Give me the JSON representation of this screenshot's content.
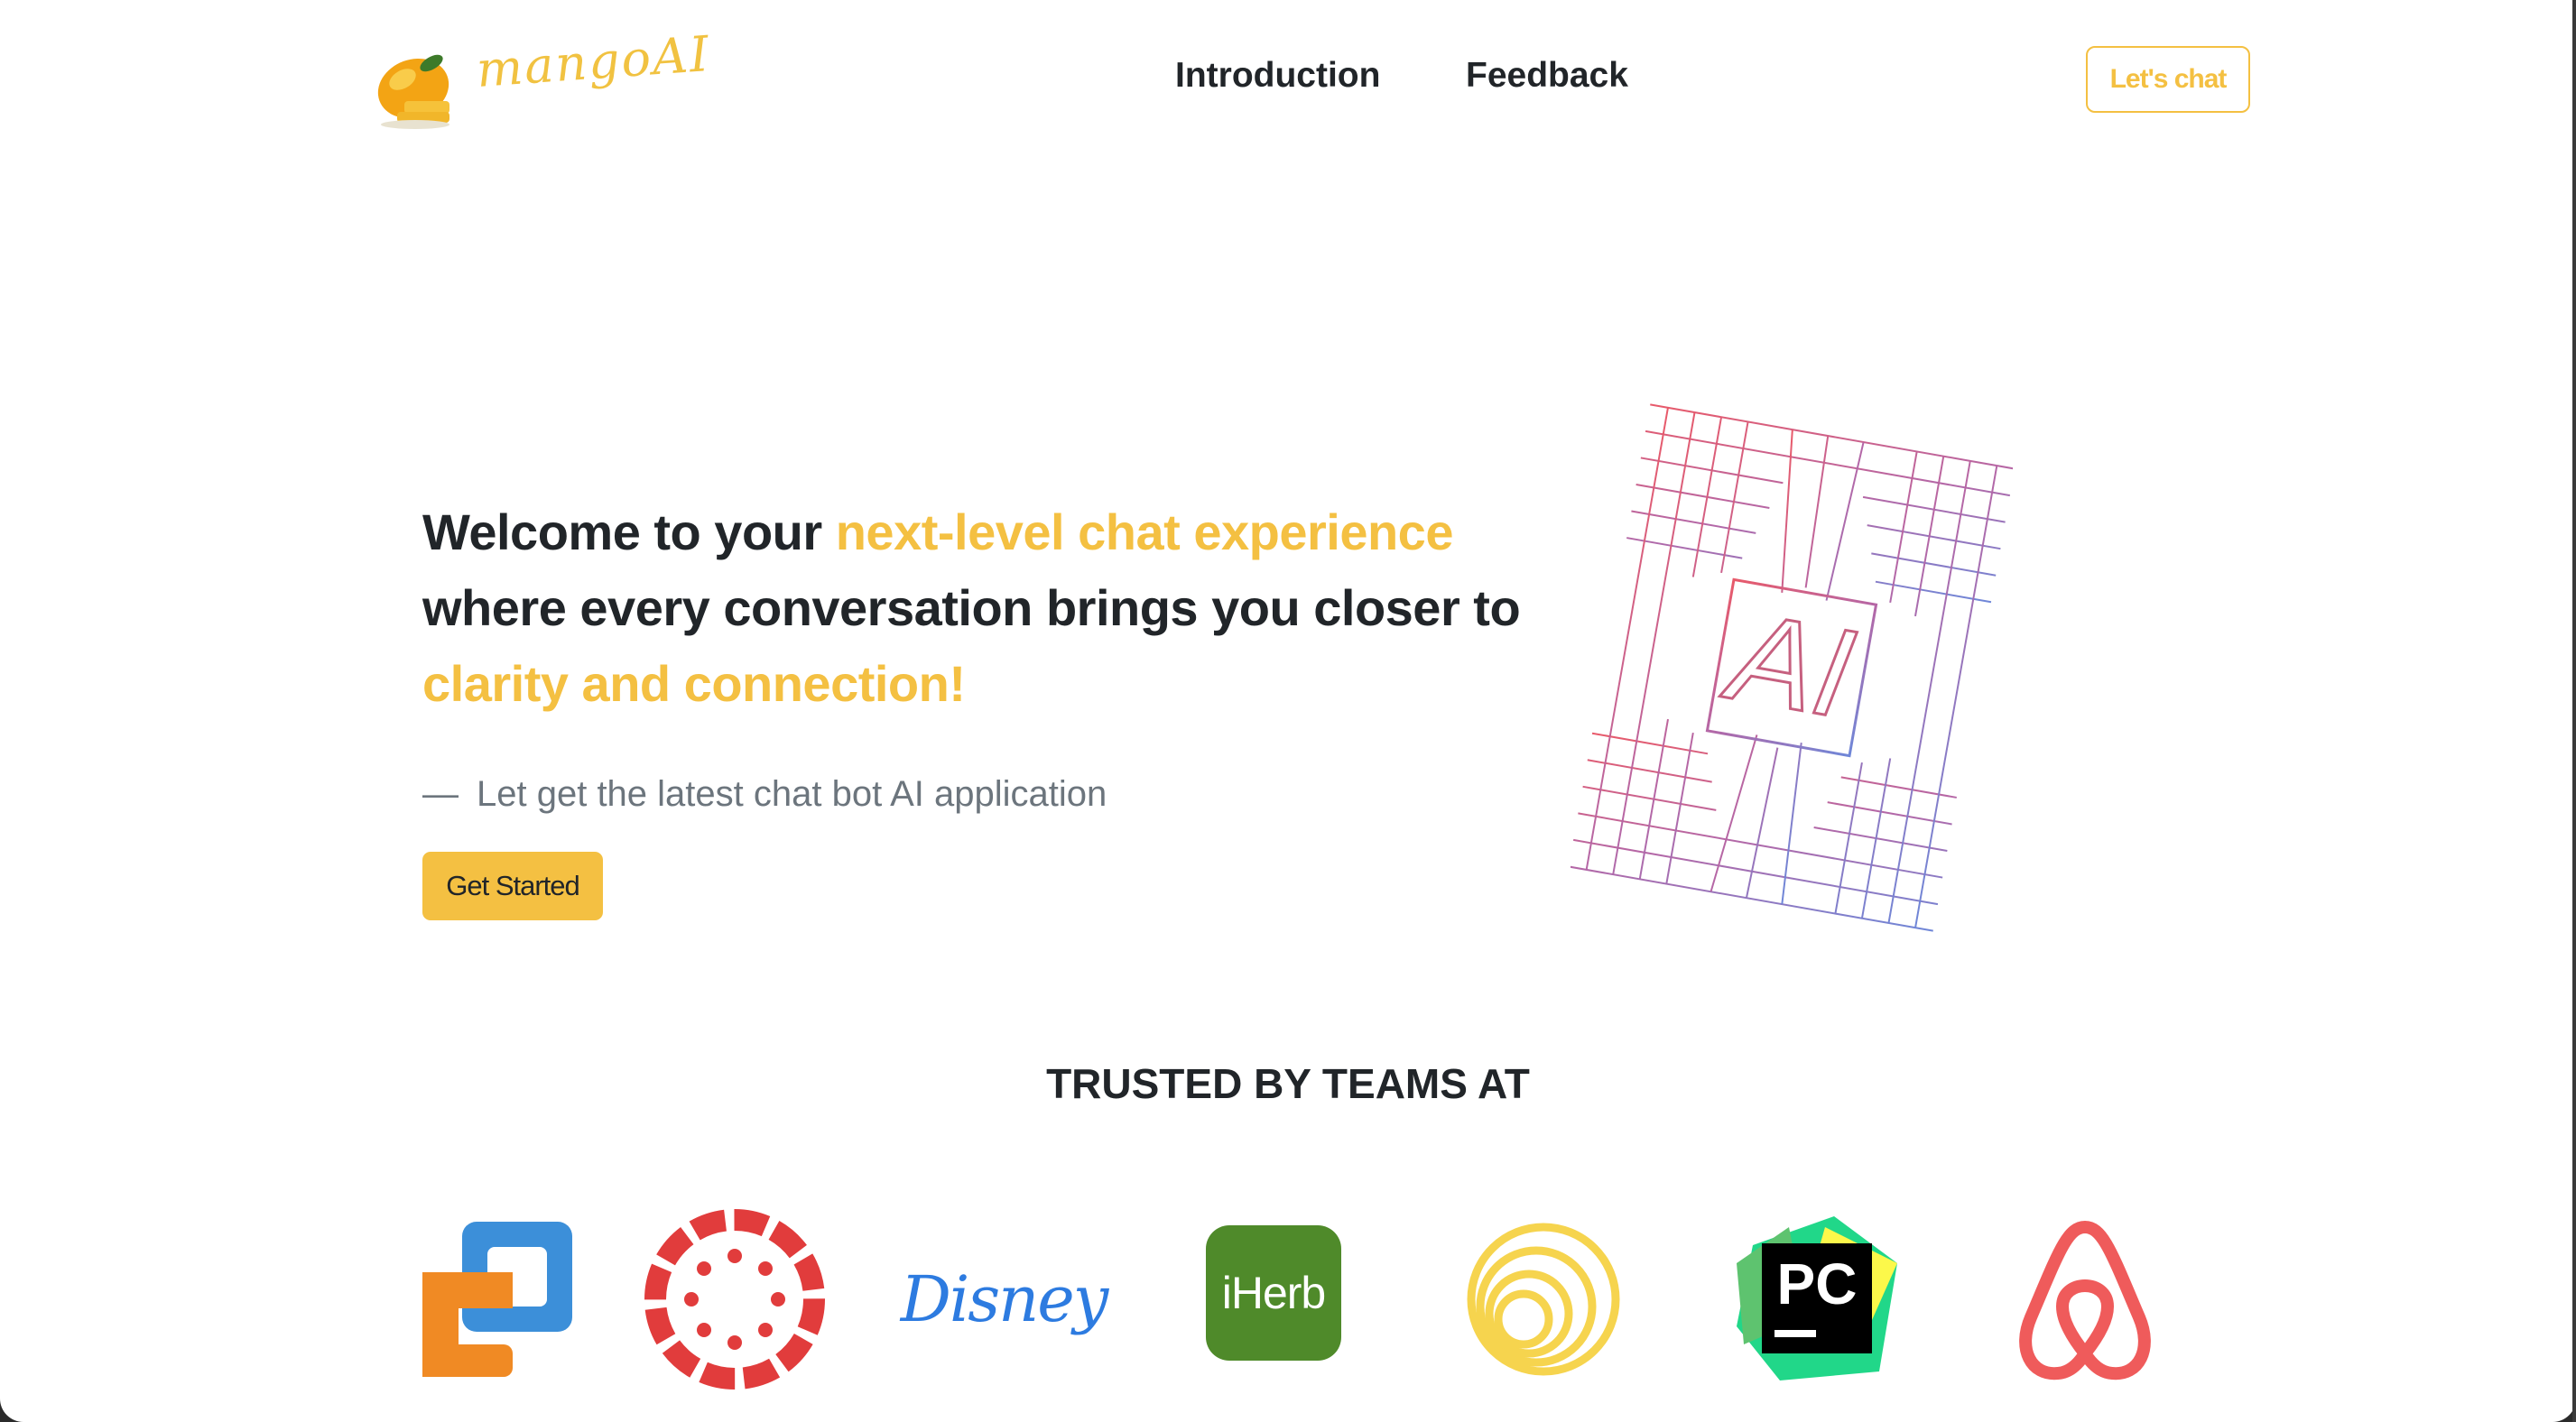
{
  "brand": {
    "name": "mangoAI"
  },
  "nav": {
    "items": [
      "Introduction",
      "Feedback"
    ],
    "cta": "Let's chat"
  },
  "hero": {
    "line1_plain": "Welcome to your ",
    "line1_highlight": "next-level chat experience",
    "line2": "where every conversation brings you closer to",
    "line3_highlight": "clarity and connection!",
    "subtitle_dash": "—",
    "subtitle": "Let get the latest chat bot AI application",
    "button": "Get Started",
    "art_text": "AI"
  },
  "trusted": {
    "title": "TRUSTED BY TEAMS AT",
    "logos": [
      {
        "name": "vmware-workstation",
        "text": ""
      },
      {
        "name": "canvas",
        "text": ""
      },
      {
        "name": "disney",
        "text": "Disney"
      },
      {
        "name": "iherb",
        "text": "iHerb"
      },
      {
        "name": "rings",
        "text": ""
      },
      {
        "name": "pycharm",
        "text": "PC"
      },
      {
        "name": "airbnb",
        "text": ""
      }
    ]
  },
  "colors": {
    "accent": "#f4c042",
    "text": "#212529",
    "muted": "#6c757d"
  }
}
